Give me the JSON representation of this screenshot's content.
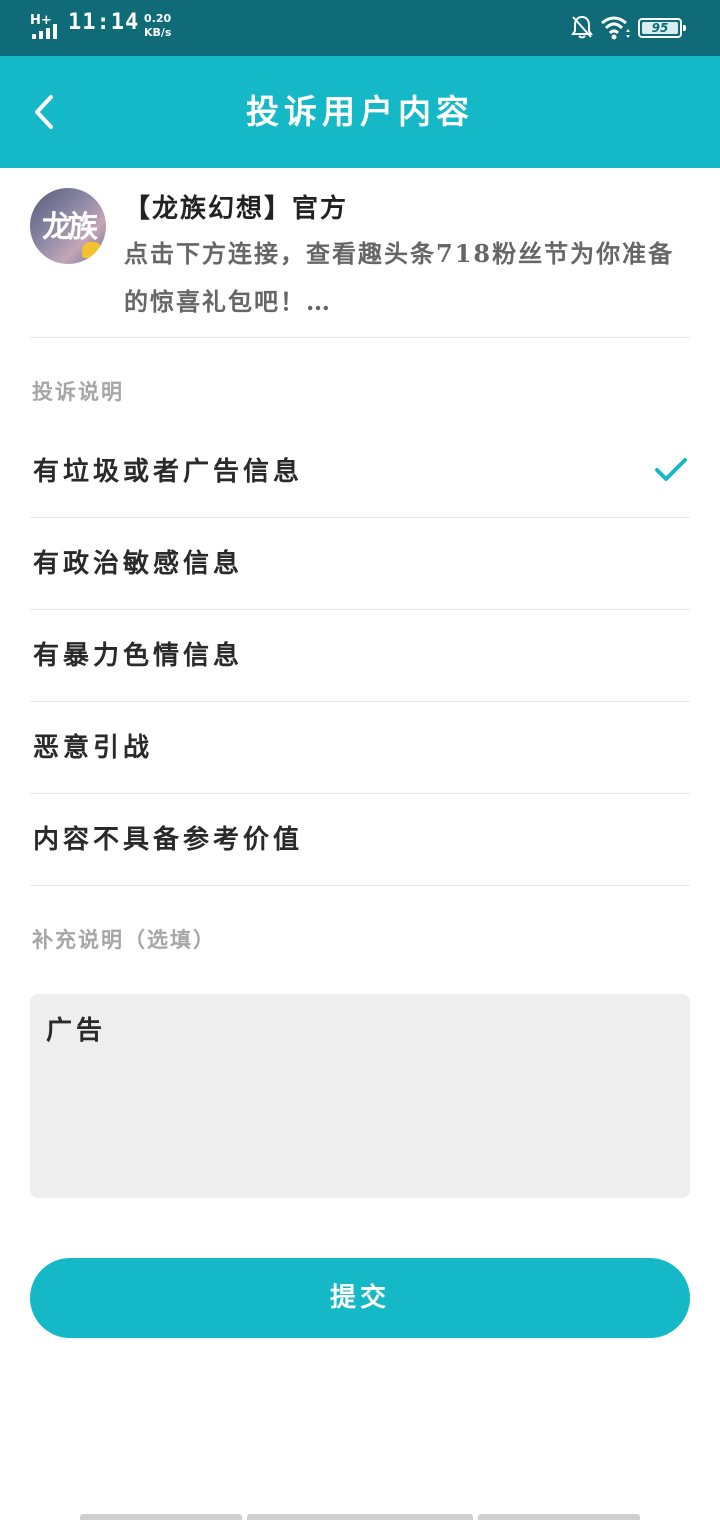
{
  "status_bar": {
    "network": "H+",
    "time": "11:14",
    "speed_value": "0.20",
    "speed_unit": "KB/s",
    "battery": "95"
  },
  "header": {
    "title": "投诉用户内容",
    "back_icon": "chevron-left-icon"
  },
  "post": {
    "author": "【龙族幻想】官方",
    "content": "点击下方连接，查看趣头条718粉丝节为你准备的惊喜礼包吧！…",
    "avatar_text": "龙族"
  },
  "complaint": {
    "section_label": "投诉说明",
    "reasons": [
      {
        "label": "有垃圾或者广告信息",
        "selected": true
      },
      {
        "label": "有政治敏感信息",
        "selected": false
      },
      {
        "label": "有暴力色情信息",
        "selected": false
      },
      {
        "label": "恶意引战",
        "selected": false
      },
      {
        "label": "内容不具备参考价值",
        "selected": false
      }
    ]
  },
  "supplement": {
    "section_label": "补充说明（选填）",
    "value": "广告"
  },
  "submit_label": "提交",
  "colors": {
    "accent": "#15b8c6",
    "status_bar": "#0f6b78"
  }
}
